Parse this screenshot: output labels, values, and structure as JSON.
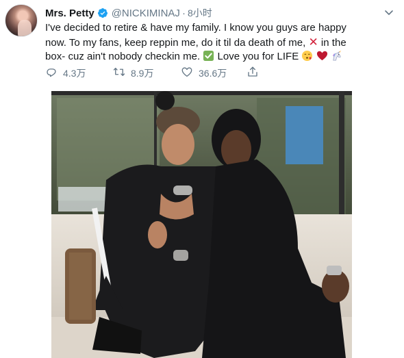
{
  "tweet": {
    "display_name": "Mrs. Petty",
    "handle": "@NICKIMINAJ",
    "separator": "·",
    "time": "8小时",
    "text_line1": "I've decided to retire & have my family. I know you guys are happy",
    "text_line2": "now. To my fans, keep reppin me, do it til da death of me,",
    "text_line2b": "in the",
    "text_line3a": "box- cuz ain't nobody checkin me.",
    "text_line3b": "Love you for LIFE",
    "x_mark": "✕",
    "icons": {
      "verified": "verified-badge-icon",
      "caret": "chevron-down-icon",
      "reply": "reply-icon",
      "retweet": "retweet-icon",
      "like": "heart-icon",
      "share": "share-icon",
      "check_emoji": "check-mark-emoji",
      "kiss_emoji": "face-blowing-kiss-emoji",
      "heart_emoji": "red-heart-emoji",
      "unicorn_emoji": "unicorn-emoji"
    }
  },
  "actions": {
    "reply_count": "4.3万",
    "retweet_count": "8.9万",
    "like_count": "36.6万"
  },
  "colors": {
    "verified_blue": "#1da1f2",
    "secondary_text": "#657786",
    "x_red": "#d2233c",
    "check_green": "#77b255"
  }
}
